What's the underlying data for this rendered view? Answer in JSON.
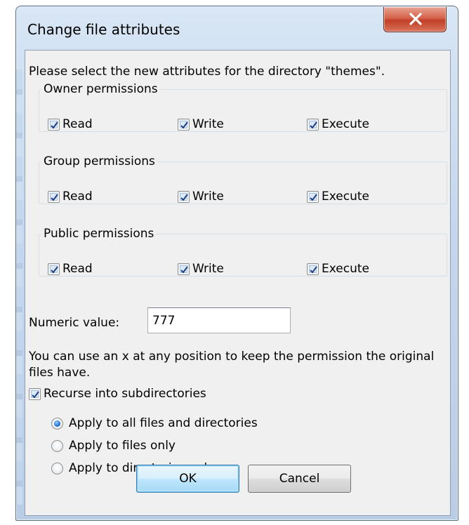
{
  "window": {
    "title": "Change file attributes",
    "close_label": "X"
  },
  "intro_text": "Please select the new attributes for the directory \"themes\".",
  "groups": [
    {
      "title": "Owner permissions",
      "read": "Read",
      "write": "Write",
      "execute": "Execute",
      "read_checked": true,
      "write_checked": true,
      "execute_checked": true
    },
    {
      "title": "Group permissions",
      "read": "Read",
      "write": "Write",
      "execute": "Execute",
      "read_checked": true,
      "write_checked": true,
      "execute_checked": true
    },
    {
      "title": "Public permissions",
      "read": "Read",
      "write": "Write",
      "execute": "Execute",
      "read_checked": true,
      "write_checked": true,
      "execute_checked": true
    }
  ],
  "numeric": {
    "label": "Numeric value:",
    "value": "777"
  },
  "hint_text": "You can use an x at any position to keep the permission the original files have.",
  "recurse": {
    "label": "Recurse into subdirectories",
    "checked": true
  },
  "apply_options": [
    {
      "label": "Apply to all files and directories",
      "selected": true
    },
    {
      "label": "Apply to files only",
      "selected": false
    },
    {
      "label": "Apply to directories only",
      "selected": false
    }
  ],
  "buttons": {
    "ok": "OK",
    "cancel": "Cancel"
  },
  "colors": {
    "close_button": "#c23f27",
    "default_button_border": "#3c7fb1",
    "checkmark": "#1d3f86",
    "radio_selected": "#1f6fcf"
  }
}
